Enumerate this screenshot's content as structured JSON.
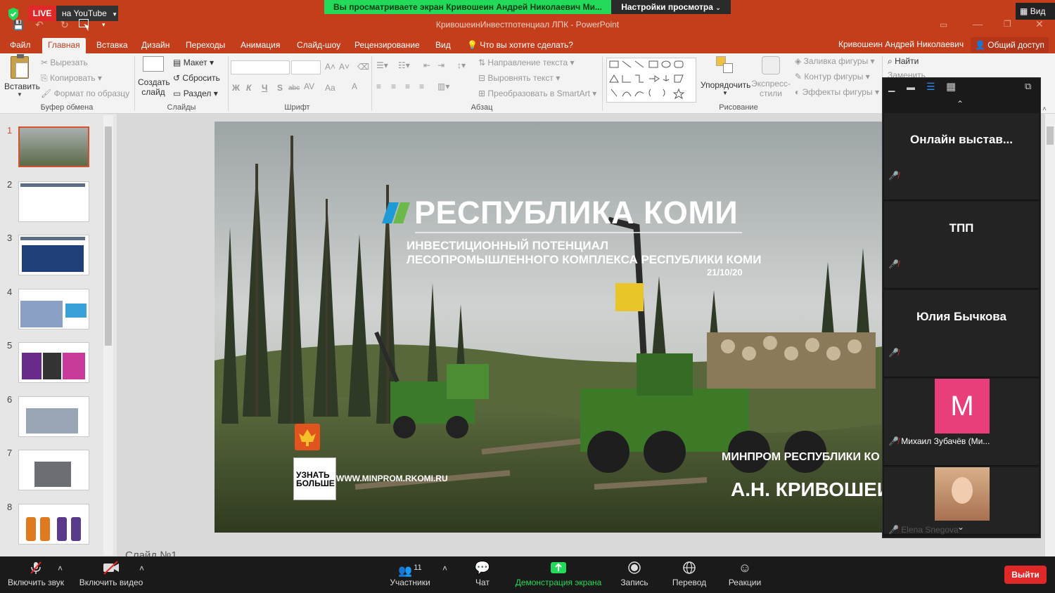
{
  "share_bar": {
    "live_badge": "LIVE",
    "live_target": "на YouTube",
    "viewing_banner": "Вы просматриваете экран Кривошеин Андрей Николаевич Ми...",
    "view_settings": "Настройки просмотра",
    "view_label": "Вид"
  },
  "window": {
    "title": "КривошеинИнвестпотенциал ЛПК - PowerPoint",
    "user_name": "Кривошеин Андрей Николаевич",
    "share_label": "Общий доступ"
  },
  "ribbon": {
    "tabs": [
      "Файл",
      "Главная",
      "Вставка",
      "Дизайн",
      "Переходы",
      "Анимация",
      "Слайд-шоу",
      "Рецензирование",
      "Вид"
    ],
    "active_tab": "Главная",
    "tell_me": "Что вы хотите сделать?",
    "clipboard": {
      "paste": "Вставить",
      "cut": "Вырезать",
      "copy": "Копировать",
      "format_painter": "Формат по образцу",
      "label": "Буфер обмена"
    },
    "slides": {
      "new_slide_1": "Создать",
      "new_slide_2": "слайд",
      "layout": "Макет",
      "reset": "Сбросить",
      "section": "Раздел",
      "label": "Слайды"
    },
    "font": {
      "label": "Шрифт",
      "bold": "Ж",
      "italic": "К",
      "underline": "Ч",
      "shadow": "S",
      "strike": "abc",
      "spacing": "AV",
      "case": "Aa",
      "color": "A"
    },
    "paragraph": {
      "text_direction": "Направление текста",
      "align_text": "Выровнять текст",
      "smartart": "Преобразовать в SmartArt",
      "label": "Абзац"
    },
    "drawing": {
      "arrange": "Упорядочить",
      "quick_styles_1": "Экспресс-",
      "quick_styles_2": "стили",
      "fill": "Заливка фигуры",
      "outline": "Контур фигуры",
      "effects": "Эффекты фигуры",
      "label": "Рисование"
    },
    "editing": {
      "find": "Найти",
      "replace": "Заменить"
    }
  },
  "thumbnails": [
    "1",
    "2",
    "3",
    "4",
    "5",
    "6",
    "7",
    "8"
  ],
  "slide": {
    "header": "РЕСПУБЛИКА КОМИ",
    "subtitle_1": "ИНВЕСТИЦИОННЫЙ ПОТЕНЦИАЛ",
    "subtitle_2": "ЛЕСОПРОМЫШЛЕННОГО КОМПЛЕКСА РЕСПУБЛИКИ КОМИ",
    "date": "21/10/20",
    "qr_text_1": "УЗНАТЬ",
    "qr_text_2": "БОЛЬШЕ",
    "website": "WWW.MINPROM.RKOMI.RU",
    "ministry": "МИНПРОМ РЕСПУБЛИКИ КО",
    "author": "А.Н. КРИВОШЕИ"
  },
  "notes_label": "Слайд №1",
  "participants_panel": {
    "tiles": [
      {
        "name": "Онлайн выстав...",
        "label_only": false
      },
      {
        "name": "ТПП",
        "label_only": false
      },
      {
        "name": "Юлия Бычкова",
        "label_only": false
      },
      {
        "name": "Михаил Зубачёв (Ми...",
        "avatar_letter": "M",
        "label_only": true
      },
      {
        "name": "Elena Snegova",
        "label_only": true
      }
    ]
  },
  "zoom_toolbar": {
    "unmute": "Включить звук",
    "start_video": "Включить видео",
    "participants": "Участники",
    "participants_count": "11",
    "chat": "Чат",
    "share_screen": "Демонстрация экрана",
    "record": "Запись",
    "translate": "Перевод",
    "reactions": "Реакции",
    "leave": "Выйти"
  },
  "colors": {
    "ppt_red": "#c43e1c",
    "zoom_green": "#23d959",
    "leave_red": "#e02828",
    "avatar_pink": "#e83e7c"
  }
}
